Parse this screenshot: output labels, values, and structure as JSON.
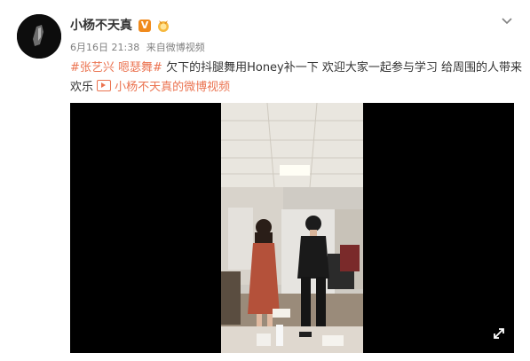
{
  "post": {
    "username": "小杨不天真",
    "verified_badge": "V",
    "date": "6月16日 21:38",
    "source_prefix": "来自",
    "source": "微博视频",
    "text": {
      "hashtag1": "#张艺兴",
      "hashtag2": "嗯瑟舞#",
      "body": "欠下的抖腿舞用Honey补一下 欢迎大家一起参与学习 给周围的人带来欢乐",
      "link_label": "小杨不天真的微博视频"
    }
  },
  "icons": {
    "avatar": "avatar-image",
    "verified": "verified-badge-icon",
    "medal": "medal-icon",
    "menu": "chevron-down-icon",
    "link": "video-link-icon",
    "fullscreen": "fullscreen-icon"
  },
  "colors": {
    "accent": "#eb7350",
    "verified": "#f08a1c",
    "meta": "#808080"
  }
}
